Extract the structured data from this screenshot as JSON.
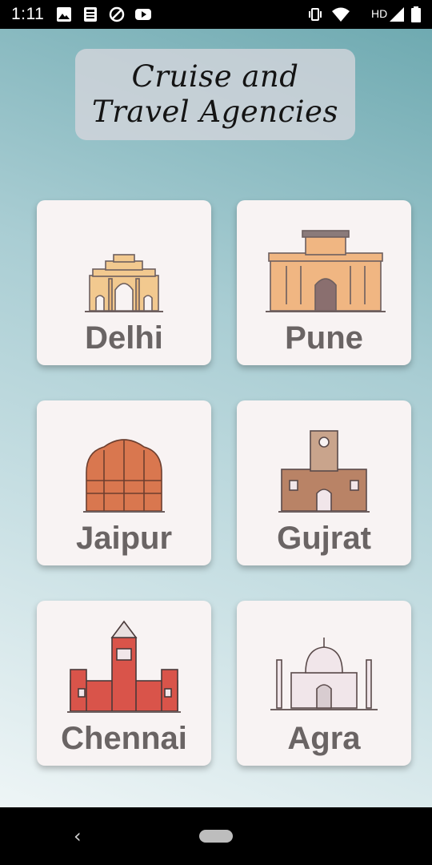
{
  "status_bar": {
    "time": "1:11",
    "left_icons": [
      "image-icon",
      "news-icon",
      "do-not-disturb-icon",
      "youtube-icon"
    ],
    "network_label": "HD",
    "right_icons": [
      "vibrate-icon",
      "wifi-icon",
      "signal-icon",
      "battery-icon"
    ]
  },
  "header": {
    "title_line1": "Cruise and",
    "title_line2": "Travel Agencies"
  },
  "cities": [
    {
      "name": "Delhi",
      "icon": "india-gate-icon",
      "color": "#f2c98f"
    },
    {
      "name": "Pune",
      "icon": "fort-icon",
      "color": "#f0b682"
    },
    {
      "name": "Jaipur",
      "icon": "hawa-mahal-icon",
      "color": "#d9774f"
    },
    {
      "name": "Gujrat",
      "icon": "clock-tower-palace-icon",
      "color": "#b98366"
    },
    {
      "name": "Chennai",
      "icon": "central-station-icon",
      "color": "#d9544a"
    },
    {
      "name": "Agra",
      "icon": "taj-mahal-icon",
      "color": "#f1e6ea"
    }
  ],
  "nav_bar": {
    "back_icon": "back-icon",
    "home_icon": "home-pill-icon"
  }
}
